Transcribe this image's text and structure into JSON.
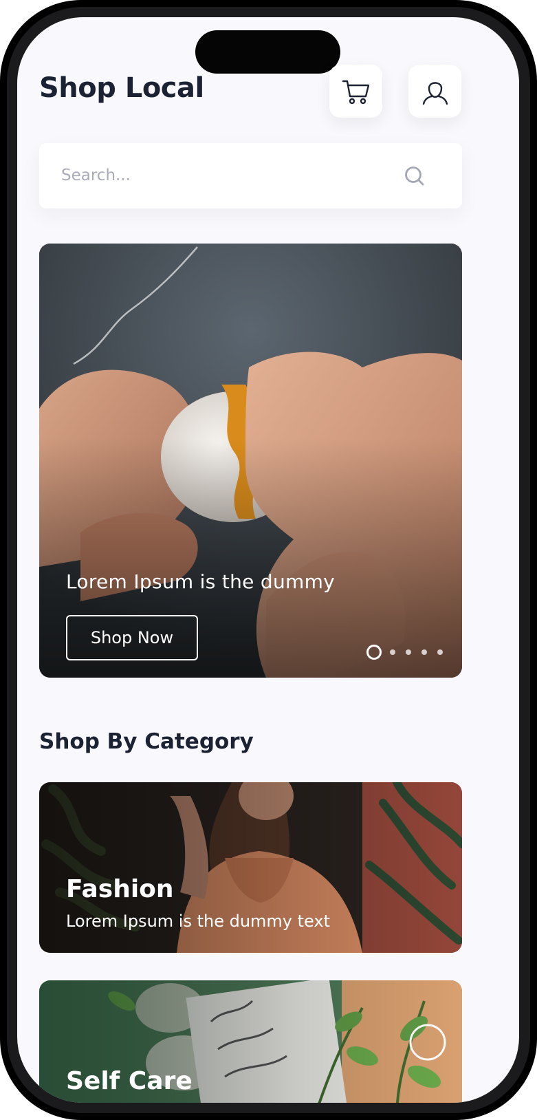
{
  "header": {
    "title": "Shop Local",
    "cart_icon": "cart-icon",
    "user_icon": "user-icon"
  },
  "search": {
    "placeholder": "Search...",
    "value": "",
    "icon": "search-icon"
  },
  "hero": {
    "headline": "Lorem Ipsum is the dummy",
    "button_label": "Shop Now",
    "slide_count": 5,
    "active_slide": 1
  },
  "categories_section": {
    "title": "Shop By Category"
  },
  "categories": [
    {
      "title": "Fashion",
      "subtitle": "Lorem Ipsum is the dummy text"
    },
    {
      "title": "Self Care",
      "subtitle": ""
    }
  ],
  "colors": {
    "background": "#f9f8fc",
    "text_dark": "#1b2233",
    "placeholder": "#a9acb8",
    "card_white": "#ffffff"
  }
}
